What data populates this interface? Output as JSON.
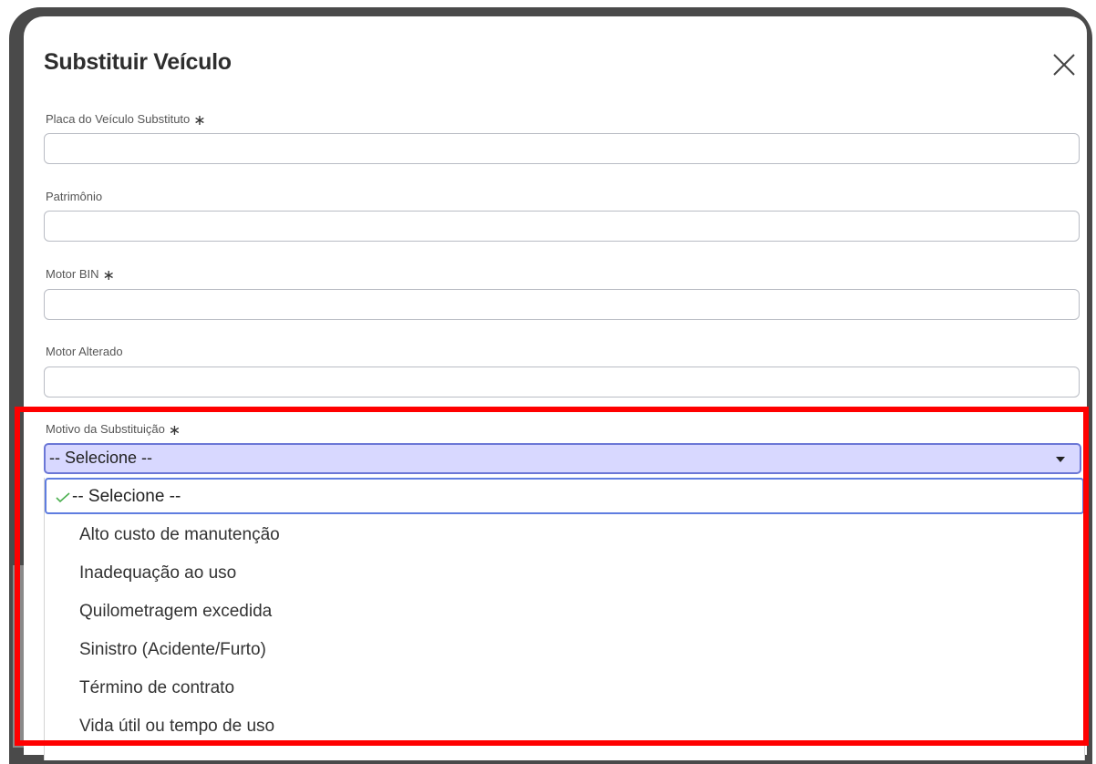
{
  "dialog": {
    "title": "Substituir Veículo",
    "close_icon": "close-icon"
  },
  "fields": {
    "placa": {
      "label": "Placa do Veículo Substituto",
      "required_mark": "∗",
      "value": ""
    },
    "patrimonio": {
      "label": "Patrimônio",
      "value": ""
    },
    "motor_bin": {
      "label": "Motor BIN",
      "required_mark": "∗",
      "value": ""
    },
    "motor_alterado": {
      "label": "Motor Alterado",
      "value": ""
    },
    "motivo": {
      "label": "Motivo da Substituição",
      "required_mark": "∗",
      "selected": "-- Selecione --",
      "options": [
        "-- Selecione --",
        "Alto custo de manutenção",
        "Inadequação ao uso",
        "Quilometragem excedida",
        "Sinistro (Acidente/Furto)",
        "Término de contrato",
        "Vida útil ou tempo de uso"
      ]
    }
  },
  "colors": {
    "select_bg": "#d8d8ff",
    "select_border": "#6b77d6",
    "highlight": "#ff0000",
    "check": "#4caf50"
  }
}
